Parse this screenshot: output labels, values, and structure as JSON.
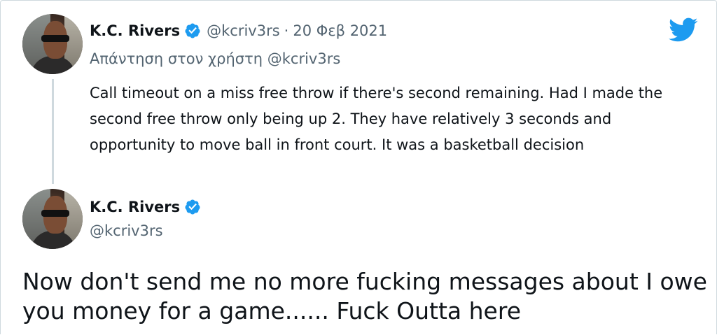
{
  "reply_tweet": {
    "author_name": "K.C. Rivers",
    "author_handle": "@kcriv3rs",
    "separator": "·",
    "date": "20 Φεβ 2021",
    "reply_to": "Απάντηση στον χρήστη @kcriv3rs",
    "text": "Call timeout on a miss free throw if there's second remaining. Had I made the second free throw only being up 2. They have relatively 3 seconds and opportunity to move ball in front court. It was a basketball decision"
  },
  "main_tweet": {
    "author_name": "K.C. Rivers",
    "author_handle": "@kcriv3rs",
    "text": "Now don't send me no more fucking messages about I owe you money for a game...... Fuck Outta here"
  },
  "icons": {
    "logo": "twitter-bird-icon",
    "verified": "verified-badge-icon"
  },
  "colors": {
    "brand_blue": "#1d9bf0",
    "secondary_text": "#536471",
    "primary_text": "#0f1419",
    "thread_line": "#cfd9de"
  }
}
